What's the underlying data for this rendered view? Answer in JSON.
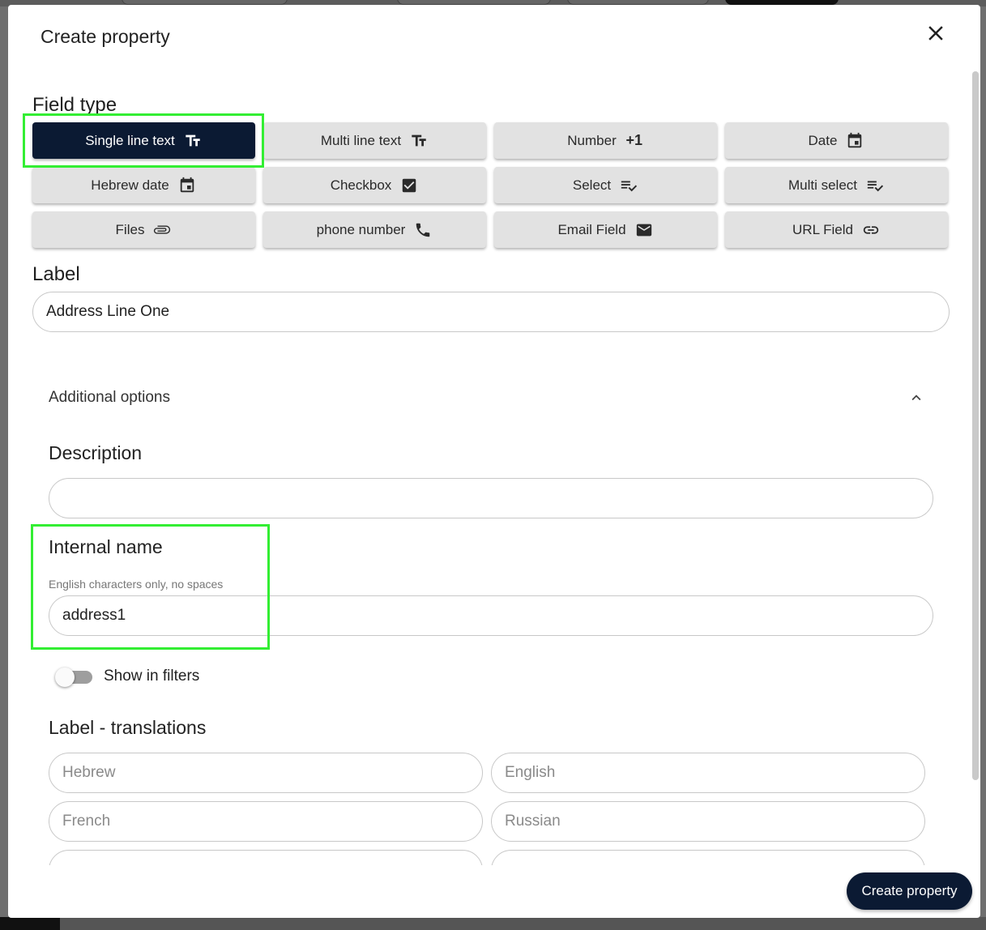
{
  "dialog": {
    "title": "Create property",
    "submit_label": "Create property"
  },
  "field_type": {
    "heading": "Field type",
    "selected": "Single line text",
    "options": [
      {
        "label": "Single line text",
        "icon": "text-fields-icon"
      },
      {
        "label": "Multi line text",
        "icon": "text-fields-icon"
      },
      {
        "label": "Number",
        "icon": "plus-one-icon",
        "icon_text": "+1"
      },
      {
        "label": "Date",
        "icon": "calendar-icon"
      },
      {
        "label": "Hebrew date",
        "icon": "calendar-icon"
      },
      {
        "label": "Checkbox",
        "icon": "checkbox-checked-icon"
      },
      {
        "label": "Select",
        "icon": "playlist-check-icon"
      },
      {
        "label": "Multi select",
        "icon": "playlist-check-icon"
      },
      {
        "label": "Files",
        "icon": "paperclip-icon"
      },
      {
        "label": "phone number",
        "icon": "phone-icon"
      },
      {
        "label": "Email Field",
        "icon": "mail-icon"
      },
      {
        "label": "URL Field",
        "icon": "link-icon"
      }
    ]
  },
  "label_field": {
    "heading": "Label",
    "value": "Address Line One"
  },
  "additional_options": {
    "title": "Additional options",
    "expanded": true,
    "description": {
      "heading": "Description",
      "value": ""
    },
    "internal_name": {
      "heading": "Internal name",
      "hint": "English characters only, no spaces",
      "value": "address1"
    },
    "show_in_filters": {
      "label": "Show in filters",
      "enabled": false
    },
    "translations": {
      "heading": "Label - translations",
      "fields": [
        {
          "placeholder": "Hebrew"
        },
        {
          "placeholder": "English"
        },
        {
          "placeholder": "French"
        },
        {
          "placeholder": "Russian"
        },
        {
          "placeholder": ""
        },
        {
          "placeholder": ""
        }
      ]
    }
  },
  "colors": {
    "primary": "#0b1a33",
    "highlight": "#33ee33",
    "button_bg": "#e2e2e2"
  }
}
